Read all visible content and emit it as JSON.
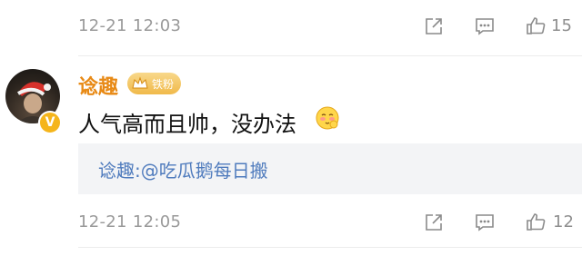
{
  "top_row": {
    "time": "12-21 12:03",
    "like_count": "15"
  },
  "comment": {
    "username": "谂趣",
    "fan_badge": "铁粉",
    "text": "人气高而且帅，没办法",
    "emoji": "blush-face",
    "reply": {
      "author": "谂趣:",
      "mention": "@吃瓜鹅每日搬"
    },
    "time": "12-21 12:05",
    "like_count": "12"
  },
  "icons": [
    "share-icon",
    "comment-icon",
    "like-icon",
    "v-verified-icon",
    "crown-icon"
  ],
  "colors": {
    "username": "#e88a16",
    "link": "#4f7bbd",
    "badge": "#f0b94a",
    "verified": "#f5b51b"
  }
}
